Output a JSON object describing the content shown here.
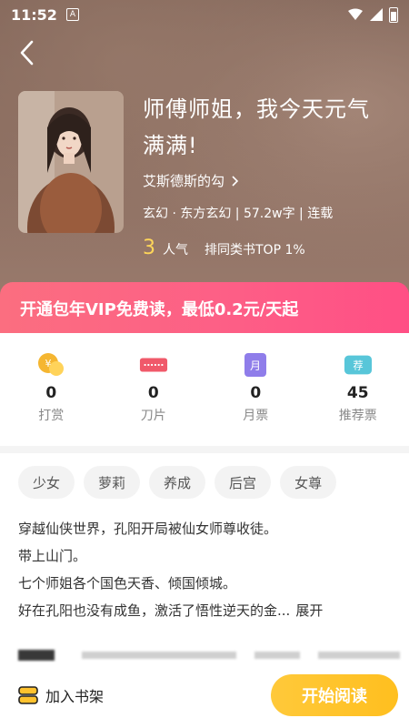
{
  "status_bar": {
    "time": "11:52",
    "indicator": "A"
  },
  "book": {
    "title": "师傅师姐，我今天元气满满!",
    "author": "艾斯德斯的勾",
    "meta": "玄幻 · 东方玄幻 | 57.2w字 | 连载",
    "popularity_value": "3",
    "popularity_label": "人气",
    "rank": "排同类书TOP 1%"
  },
  "vip_banner": {
    "text": "开通包年VIP免费读，最低0.2元/天起"
  },
  "actions": [
    {
      "count": "0",
      "label": "打赏",
      "icon": "coin-icon"
    },
    {
      "count": "0",
      "label": "刀片",
      "icon": "blade-icon"
    },
    {
      "count": "0",
      "label": "月票",
      "icon": "monthly-ticket-icon",
      "icon_text": "月"
    },
    {
      "count": "45",
      "label": "推荐票",
      "icon": "recommend-ticket-icon",
      "icon_text": "荐"
    }
  ],
  "tags": [
    "少女",
    "萝莉",
    "养成",
    "后宫",
    "女尊"
  ],
  "description": {
    "lines": [
      "穿越仙侠世界，孔阳开局被仙女师尊收徒。",
      "带上山门。",
      "七个师姐各个国色天香、倾国倾城。",
      "好在孔阳也没有成鱼，激活了悟性逆天的金..."
    ],
    "expand_label": "展开"
  },
  "bottom_bar": {
    "shelf_label": "加入书架",
    "start_label": "开始阅读"
  },
  "colors": {
    "accent_pink": "#fd5f86",
    "accent_yellow": "#ffc22e",
    "popularity": "#ffd659"
  }
}
